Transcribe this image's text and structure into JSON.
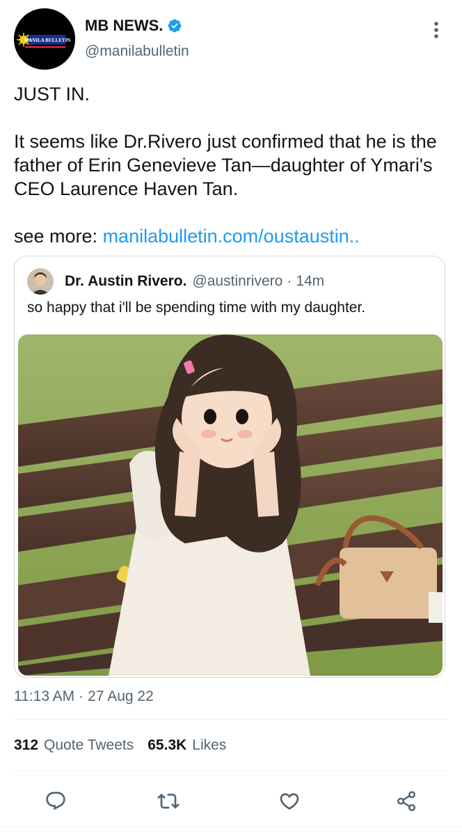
{
  "author": {
    "display_name": "MB NEWS.",
    "handle": "@manilabulletin",
    "avatar_icon": "manila-bulletin-logo",
    "verified_icon": "verified-badge-icon",
    "verified_color": "#1d9bf0"
  },
  "more_icon": "kebab-menu-icon",
  "tweet": {
    "line1": "JUST IN.",
    "line2": "It seems like Dr.Rivero just confirmed that he is the father of Erin Genevieve Tan—daughter of Ymari's CEO Laurence Haven Tan.",
    "see_more_label": "see more: ",
    "see_more_link": "manilabulletin.com/oustaustin.."
  },
  "quote": {
    "display_name": "Dr. Austin Rivero.",
    "handle": "@austinrivero",
    "separator": "·",
    "time": "14m",
    "text": "so happy that i'll be spending time with my daughter.",
    "photo_icon": "girl-on-bench-photo"
  },
  "meta": {
    "time": "11:13 AM",
    "separator": "·",
    "date": "27 Aug 22"
  },
  "stats": {
    "quote_tweets_count": "312",
    "quote_tweets_label": "Quote Tweets",
    "likes_count": "65.3K",
    "likes_label": "Likes"
  },
  "actions": {
    "reply_icon": "reply-icon",
    "retweet_icon": "retweet-icon",
    "like_icon": "heart-icon",
    "share_icon": "share-icon",
    "icon_color": "#536471"
  },
  "colors": {
    "text": "#0f1419",
    "secondary": "#536471",
    "link": "#1d9bf0",
    "border": "#cfd9de"
  }
}
